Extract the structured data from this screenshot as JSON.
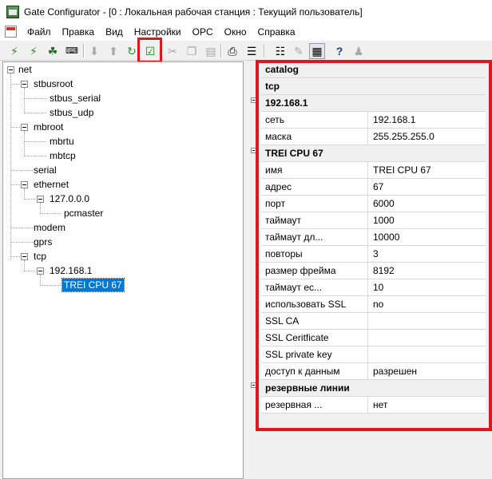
{
  "window": {
    "title": "Gate Configurator - [0 : Локальная рабочая станция : Текущий пользователь]"
  },
  "menu": [
    "Файл",
    "Правка",
    "Вид",
    "Настройки",
    "OPC",
    "Окно",
    "Справка"
  ],
  "toolbar": {
    "buttons": [
      "connect-icon",
      "disconnect-icon",
      "network-icon",
      "keyboard-icon",
      "move-down-icon",
      "move-up-icon",
      "refresh-icon",
      "check-apply-icon",
      "cut-icon",
      "copy-icon",
      "paste-icon",
      "print-icon",
      "list-view-icon",
      "export-icon",
      "properties-icon",
      "help-pointer-icon",
      "user-icon"
    ],
    "highlight_color": "#e0151f"
  },
  "tree": {
    "nodes": [
      {
        "label": "net"
      },
      {
        "label": "stbusroot"
      },
      {
        "label": "stbus_serial"
      },
      {
        "label": "stbus_udp"
      },
      {
        "label": "mbroot"
      },
      {
        "label": "mbrtu"
      },
      {
        "label": "mbtcp"
      },
      {
        "label": "serial"
      },
      {
        "label": "ethernet"
      },
      {
        "label": "127.0.0.0"
      },
      {
        "label": "pcmaster"
      },
      {
        "label": "modem"
      },
      {
        "label": "gprs"
      },
      {
        "label": "tcp"
      },
      {
        "label": "192.168.1"
      },
      {
        "label": "TREI CPU 67",
        "selected": true
      }
    ]
  },
  "properties": {
    "rows": [
      {
        "type": "category",
        "key": "catalog"
      },
      {
        "type": "category",
        "key": "tcp"
      },
      {
        "type": "category",
        "key": "192.168.1"
      },
      {
        "type": "prop",
        "key": "сеть",
        "value": "192.168.1"
      },
      {
        "type": "prop",
        "key": "маска",
        "value": "255.255.255.0"
      },
      {
        "type": "category",
        "key": "TREI CPU 67"
      },
      {
        "type": "prop",
        "key": "имя",
        "value": "TREI CPU 67"
      },
      {
        "type": "prop",
        "key": "адрес",
        "value": "67"
      },
      {
        "type": "prop",
        "key": "порт",
        "value": "6000"
      },
      {
        "type": "prop",
        "key": "таймаут",
        "value": "1000"
      },
      {
        "type": "prop",
        "key": "таймаут дл...",
        "value": "10000"
      },
      {
        "type": "prop",
        "key": "повторы",
        "value": "3"
      },
      {
        "type": "prop",
        "key": "размер фрейма",
        "value": "8192"
      },
      {
        "type": "prop",
        "key": "таймаут ес...",
        "value": "10"
      },
      {
        "type": "prop",
        "key": "использовать SSL",
        "value": "no"
      },
      {
        "type": "prop",
        "key": "SSL CA",
        "value": ""
      },
      {
        "type": "prop",
        "key": "SSL Ceritficate",
        "value": ""
      },
      {
        "type": "prop",
        "key": "SSL private key",
        "value": ""
      },
      {
        "type": "prop",
        "key": "доступ к данным",
        "value": "разрешен"
      },
      {
        "type": "category",
        "key": "резервные линии"
      },
      {
        "type": "prop",
        "key": "резервная ...",
        "value": "нет"
      }
    ]
  }
}
